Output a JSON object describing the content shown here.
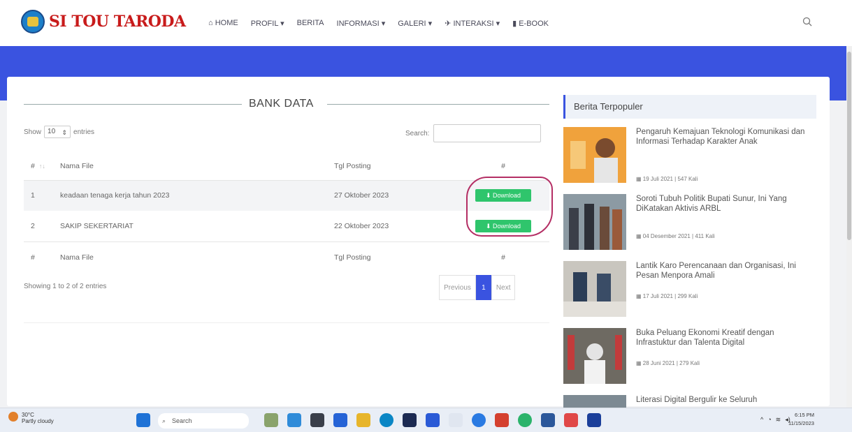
{
  "header": {
    "brand": "SI TOU TARODA",
    "nav": [
      {
        "icon": "home-icon",
        "label": "HOME"
      },
      {
        "icon": "",
        "label": "PROFIL"
      },
      {
        "icon": "",
        "label": "BERITA"
      },
      {
        "icon": "",
        "label": "INFORMASI"
      },
      {
        "icon": "",
        "label": "GALERI"
      },
      {
        "icon": "rocket-icon",
        "label": "INTERAKSI"
      },
      {
        "icon": "book-icon",
        "label": "E-BOOK"
      }
    ],
    "accent_color": "#3a53e0"
  },
  "bank": {
    "title": "BANK DATA",
    "show_label": "Show",
    "entries_value": "10",
    "entries_label": "entries",
    "search_label": "Search:",
    "columns": [
      "#",
      "Nama File",
      "Tgl Posting",
      "#"
    ],
    "rows": [
      {
        "no": "1",
        "name": "keadaan tenaga kerja tahun 2023",
        "date": "27 Oktober 2023",
        "action": "Download"
      },
      {
        "no": "2",
        "name": "SAKIP SEKERTARIAT",
        "date": "22 Oktober 2023",
        "action": "Download"
      }
    ],
    "footer": [
      "#",
      "Nama File",
      "Tgl Posting",
      "#"
    ],
    "info": "Showing 1 to 2 of 2 entries",
    "pager": {
      "prev": "Previous",
      "current": "1",
      "next": "Next"
    }
  },
  "sidebar": {
    "title": "Berita Terpopuler",
    "news": [
      {
        "title": "Pengaruh Kemajuan Teknologi Komunikasi dan Informasi Terhadap Karakter Anak",
        "meta": "19 Juli 2021 | 547 Kali"
      },
      {
        "title": "Soroti Tubuh Politik Bupati Sunur, Ini Yang DiKatakan Aktivis ARBL",
        "meta": "04 Desember 2021 | 411 Kali"
      },
      {
        "title": "Lantik Karo Perencanaan dan Organisasi, Ini Pesan Menpora Amali",
        "meta": "17 Juli 2021 | 299 Kali"
      },
      {
        "title": "Buka Peluang Ekonomi Kreatif dengan Infrastuktur dan Talenta Digital",
        "meta": "28 Juni 2021 | 279 Kali"
      },
      {
        "title": "Literasi Digital Bergulir ke Seluruh",
        "meta": ""
      }
    ]
  },
  "taskbar": {
    "temp": "30°C",
    "weather": "Partly cloudy",
    "search": "Search",
    "time": "6:15 PM",
    "date": "11/15/2023"
  }
}
